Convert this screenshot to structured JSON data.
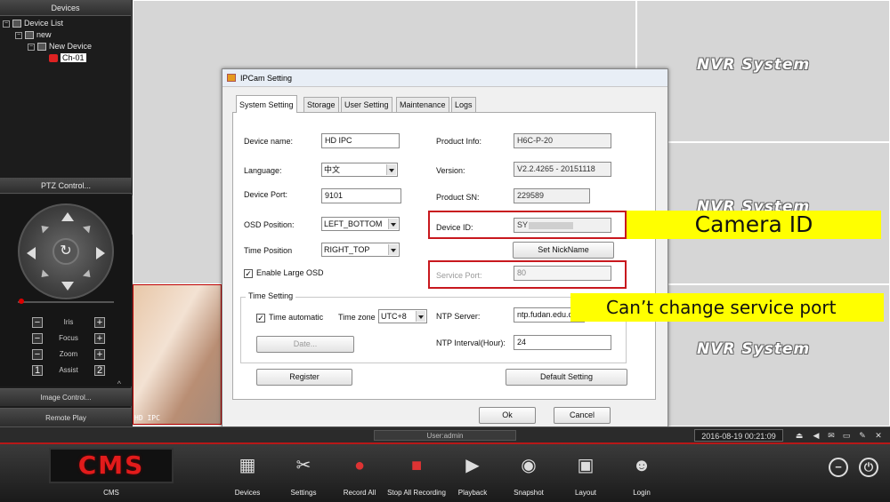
{
  "left_panel": {
    "devices_header": "Devices",
    "tree": {
      "root": "Device List",
      "group": "new",
      "device": "New Device",
      "channel": "Ch-01"
    },
    "ptz_header": "PTZ Control...",
    "ptz_rows": [
      {
        "minus": "−",
        "label": "Iris",
        "plus": "+"
      },
      {
        "minus": "−",
        "label": "Focus",
        "plus": "+"
      },
      {
        "minus": "−",
        "label": "Zoom",
        "plus": "+"
      },
      {
        "minus": "1",
        "label": "Assist",
        "plus": "2"
      }
    ],
    "image_control": "Image Control...",
    "remote_play": "Remote Play",
    "collapse_glyph": "«",
    "expand_up_glyph": "^"
  },
  "video_grid": {
    "logo_text": "NVR System",
    "feed_label": "HD  IPC"
  },
  "dialog": {
    "title": "IPCam Setting",
    "tabs": [
      "System Setting",
      "Storage",
      "User Setting",
      "Maintenance",
      "Logs"
    ],
    "active_tab": "System Setting",
    "left_fields": {
      "device_name": {
        "label": "Device name:",
        "value": "HD IPC"
      },
      "language": {
        "label": "Language:",
        "value": "中文"
      },
      "device_port": {
        "label": "Device Port:",
        "value": "9101"
      },
      "osd_position": {
        "label": "OSD Position:",
        "value": "LEFT_BOTTOM"
      },
      "time_position": {
        "label": "Time Position",
        "value": "RIGHT_TOP"
      },
      "large_osd": {
        "label": "Enable Large OSD",
        "checked": true
      }
    },
    "right_fields": {
      "product_info": {
        "label": "Product Info:",
        "value": "H6C-P-20"
      },
      "version": {
        "label": "Version:",
        "value": "V2.2.4265 - 20151118"
      },
      "product_sn": {
        "label": "Product SN:",
        "value": "229589"
      },
      "device_id": {
        "label": "Device ID:",
        "value": "SY"
      },
      "set_nickname": "Set NickName",
      "service_port": {
        "label": "Service Port:",
        "value": "80"
      }
    },
    "time_setting": {
      "title": "Time Setting",
      "time_automatic": {
        "label": "Time automatic",
        "checked": true
      },
      "time_zone": {
        "label": "Time zone",
        "value": "UTC+8"
      },
      "date_button": "Date...",
      "ntp_server": {
        "label": "NTP Server:",
        "value": "ntp.fudan.edu.c"
      },
      "ntp_interval": {
        "label": "NTP Interval(Hour):",
        "value": "24"
      }
    },
    "register_button": "Register",
    "default_button": "Default Setting",
    "ok_button": "Ok",
    "cancel_button": "Cancel"
  },
  "annotations": {
    "camera_id": "Camera ID",
    "service_port_note": "Can’t change service port",
    "highlight_color": "#ffff00",
    "box_color": "#c8181e"
  },
  "status_bar": {
    "user": "User:admin",
    "datetime": "2016-08-19 00:21:09",
    "icons": [
      "eject-icon",
      "volume-icon",
      "mail-icon",
      "screen-icon",
      "pin-icon",
      "tools-icon"
    ]
  },
  "toolbar": {
    "logo": "CMS",
    "logo_label": "CMS",
    "items": [
      {
        "label": "Devices",
        "icon": "devices-icon"
      },
      {
        "label": "Settings",
        "icon": "settings-icon"
      },
      {
        "label": "Record All",
        "icon": "record-all-icon"
      },
      {
        "label": "Stop All Recording",
        "icon": "stop-recording-icon"
      },
      {
        "label": "Playback",
        "icon": "playback-icon"
      },
      {
        "label": "Snapshot",
        "icon": "snapshot-icon"
      },
      {
        "label": "Layout",
        "icon": "layout-icon"
      },
      {
        "label": "Login",
        "icon": "login-icon"
      }
    ]
  }
}
